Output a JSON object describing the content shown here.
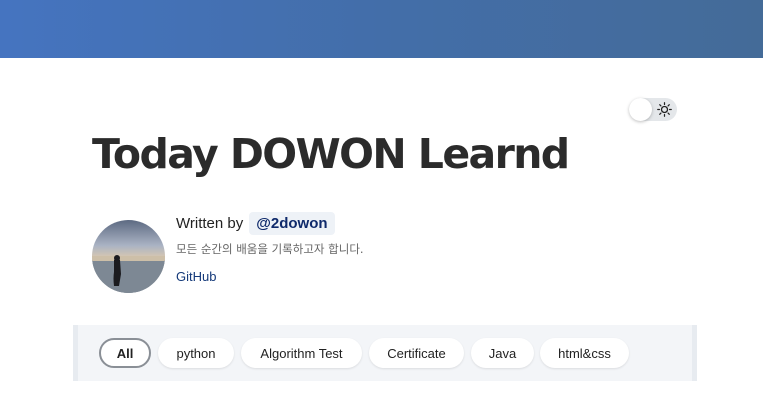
{
  "header": {
    "banner_colors": [
      "#4574c0",
      "#436ea9",
      "#446b98"
    ]
  },
  "theme_toggle": {
    "icon": "sun-icon",
    "state": "light"
  },
  "title": "Today DOWON Learnd",
  "author": {
    "written_by": "Written by",
    "handle": "@2dowon",
    "description": "모든 순간의 배움을 기록하고자 합니다.",
    "github_label": "GitHub"
  },
  "categories": {
    "selected": "All",
    "items": [
      "All",
      "python",
      "Algorithm Test",
      "Certificate",
      "Java",
      "html&css"
    ]
  }
}
